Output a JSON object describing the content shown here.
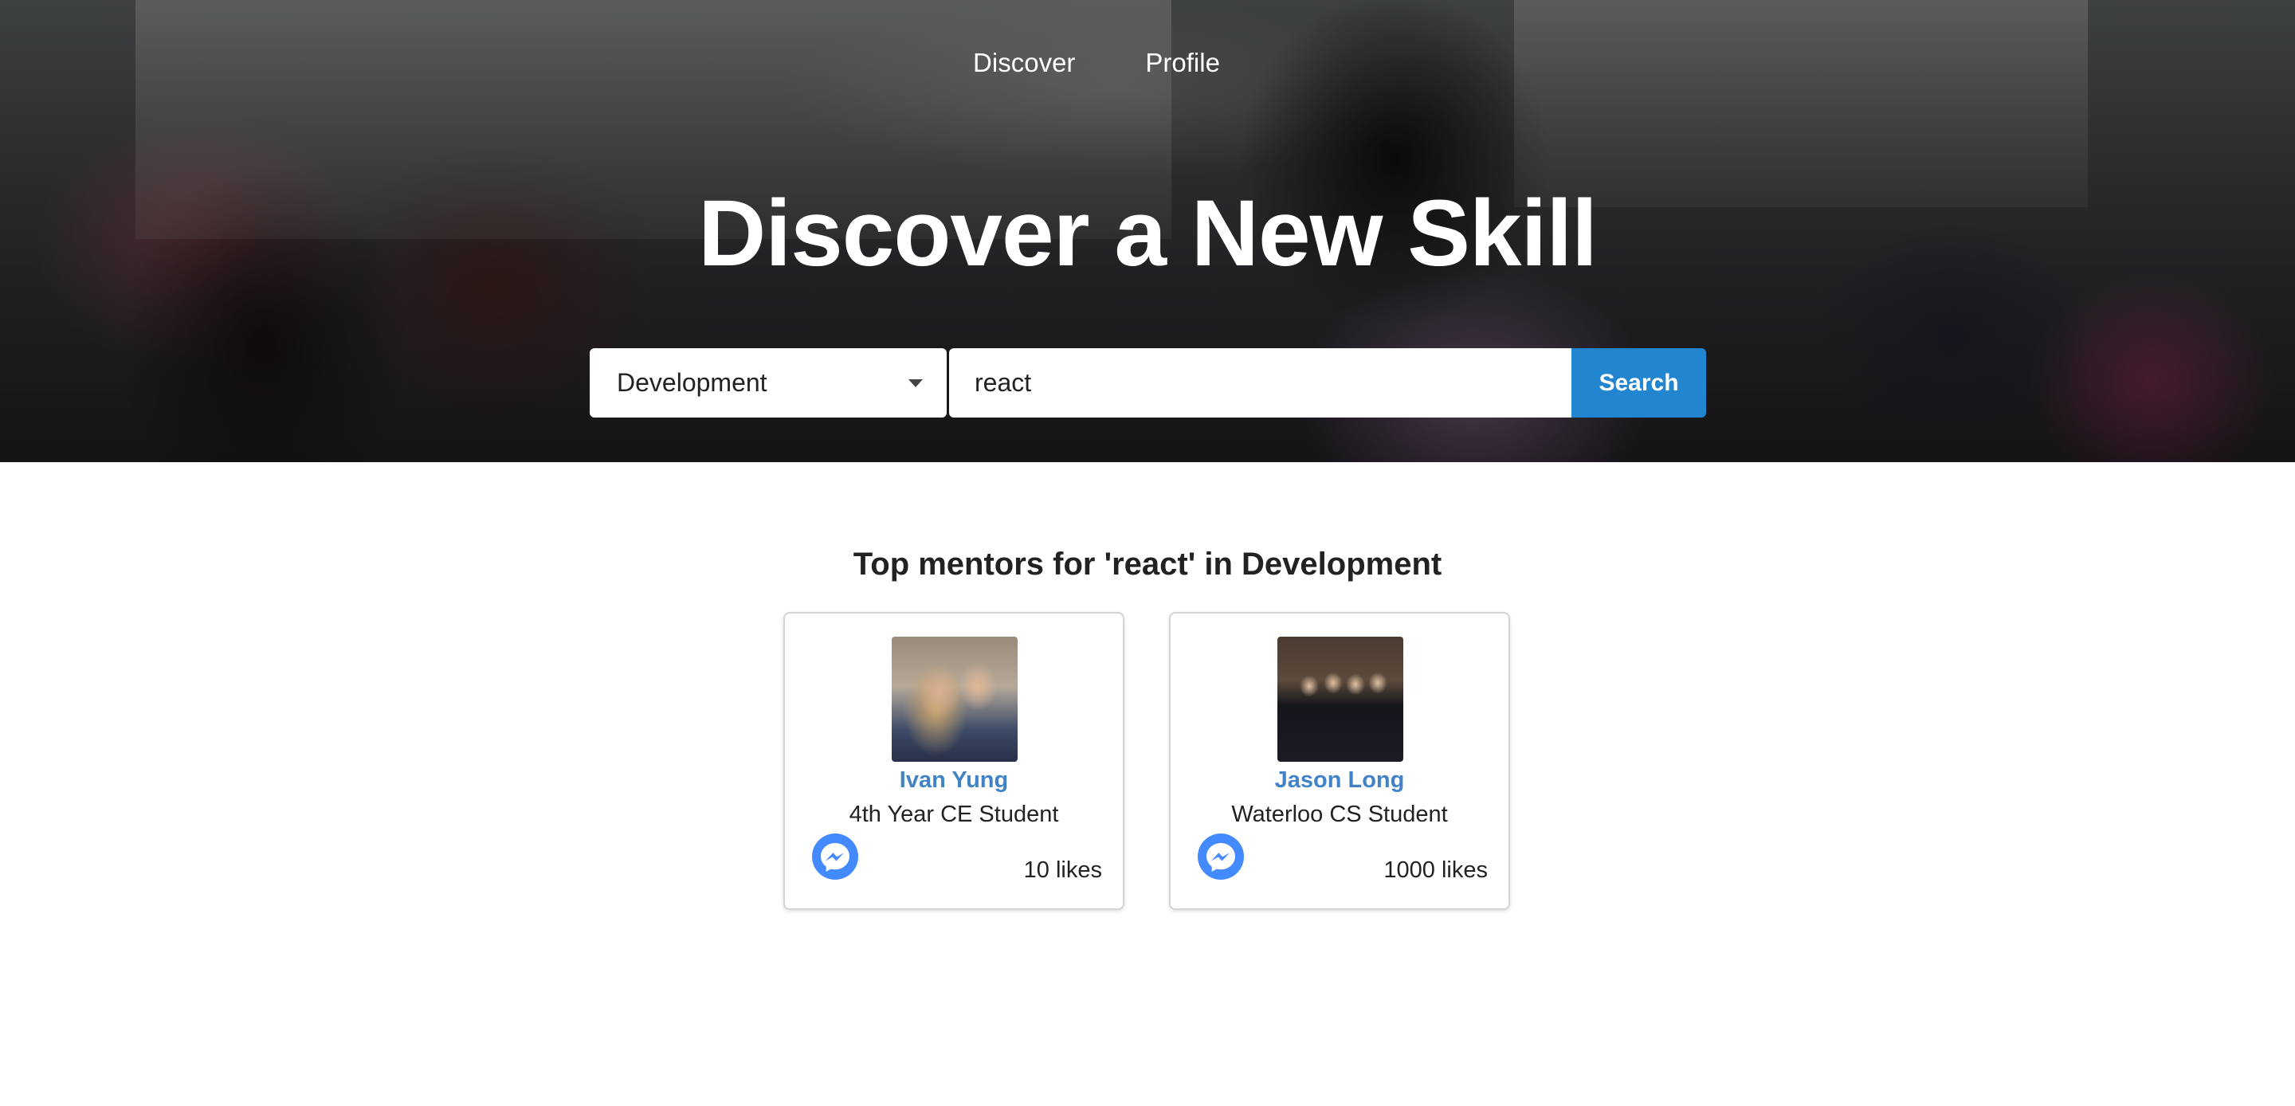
{
  "nav": {
    "items": [
      {
        "label": "Discover"
      },
      {
        "label": "Profile"
      }
    ]
  },
  "hero": {
    "title": "Discover a New Skill"
  },
  "search": {
    "category_selected": "Development",
    "query_value": "react",
    "button_label": "Search"
  },
  "results": {
    "heading": "Top mentors for 'react' in Development",
    "mentors": [
      {
        "name": "Ivan Yung",
        "description": "4th Year CE Student",
        "likes": "10 likes"
      },
      {
        "name": "Jason Long",
        "description": "Waterloo CS Student",
        "likes": "1000 likes"
      }
    ]
  },
  "colors": {
    "accent": "#2185d0",
    "link": "#4183c4",
    "messenger": "#448aff"
  },
  "icons": [
    "dropdown-caret-icon",
    "messenger-icon"
  ]
}
